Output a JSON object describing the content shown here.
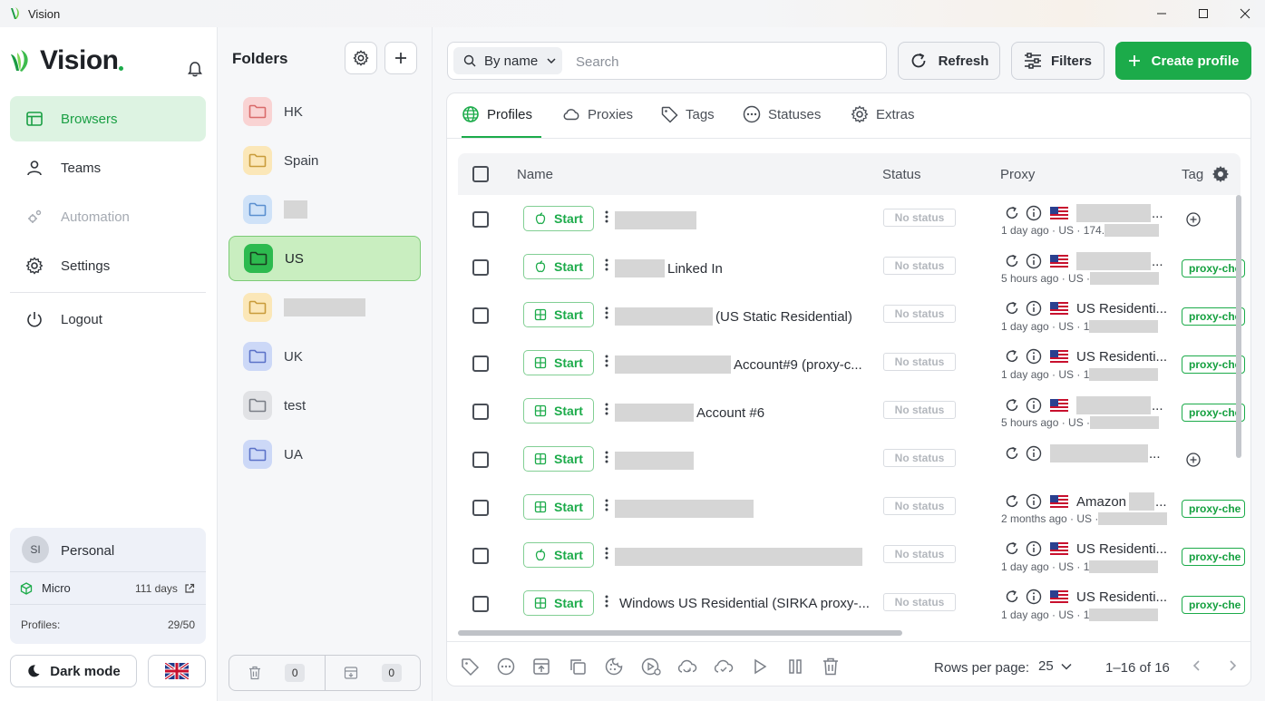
{
  "window": {
    "title": "Vision"
  },
  "sidebar": {
    "logo": "Vision",
    "nav": [
      {
        "label": "Browsers",
        "icon": "browsers-icon",
        "state": "active"
      },
      {
        "label": "Teams",
        "icon": "user-icon",
        "state": "normal"
      },
      {
        "label": "Automation",
        "icon": "automation-icon",
        "state": "disabled"
      },
      {
        "label": "Settings",
        "icon": "gear-icon",
        "state": "normal"
      },
      {
        "label": "Logout",
        "icon": "power-icon",
        "state": "normal"
      }
    ],
    "plan": {
      "avatar": "SI",
      "name": "Personal",
      "tier": "Micro",
      "days": "111 days",
      "profiles_label": "Profiles:",
      "profiles_count": "29/50"
    },
    "dark_mode_label": "Dark mode",
    "language_flag": "uk-flag-icon"
  },
  "folders": {
    "title": "Folders",
    "items": [
      {
        "name": "HK",
        "color": "#f9d3d3",
        "stroke": "#d96b6b"
      },
      {
        "name": "Spain",
        "color": "#fbe7b8",
        "stroke": "#c99c3b"
      },
      {
        "name": "",
        "color": "#cfe2f8",
        "stroke": "#5a8fd0"
      },
      {
        "name": "US",
        "color": "#2dba4f",
        "stroke": "#1a3d20"
      },
      {
        "name": "",
        "color": "#fbe7b8",
        "stroke": "#c99c3b"
      },
      {
        "name": "UK",
        "color": "#ccd8f7",
        "stroke": "#5b72c8"
      },
      {
        "name": "test",
        "color": "#e1e2e5",
        "stroke": "#7a7e86"
      },
      {
        "name": "UA",
        "color": "#ccd8f7",
        "stroke": "#5b72c8"
      }
    ],
    "active_index": 3,
    "trash_count": "0",
    "archive_count": "0"
  },
  "toolbar": {
    "search_mode": "By name",
    "search_placeholder": "Search",
    "refresh_label": "Refresh",
    "filters_label": "Filters",
    "create_label": "Create profile"
  },
  "tabs": [
    {
      "label": "Profiles",
      "icon": "globe-icon"
    },
    {
      "label": "Proxies",
      "icon": "cloud-icon"
    },
    {
      "label": "Tags",
      "icon": "tag-icon"
    },
    {
      "label": "Statuses",
      "icon": "dots-circle-icon"
    },
    {
      "label": "Extras",
      "icon": "gear-icon"
    }
  ],
  "table": {
    "columns": [
      "Name",
      "Status",
      "Proxy",
      "Tag"
    ],
    "rows": [
      {
        "os": "mac",
        "start": "Start",
        "name": "",
        "status": "No status",
        "proxy_name": "",
        "proxy_meta": "1 day ago · US · 174.",
        "flag": true,
        "tag": ""
      },
      {
        "os": "mac",
        "start": "Start",
        "name": "Linked In",
        "status": "No status",
        "proxy_name": "",
        "proxy_meta": "5 hours ago · US · ",
        "flag": true,
        "tag": "proxy-che"
      },
      {
        "os": "win",
        "start": "Start",
        "name": "(US Static Residential)",
        "status": "No status",
        "proxy_name": "US Residenti...",
        "proxy_meta": "1 day ago · US · 1",
        "flag": true,
        "tag": "proxy-che"
      },
      {
        "os": "win",
        "start": "Start",
        "name": "Account#9 (proxy-c...",
        "status": "No status",
        "proxy_name": "US Residenti...",
        "proxy_meta": "1 day ago · US · 1",
        "flag": true,
        "tag": "proxy-che"
      },
      {
        "os": "win",
        "start": "Start",
        "name": "Account #6",
        "status": "No status",
        "proxy_name": "",
        "proxy_meta": "5 hours ago · US · ",
        "flag": true,
        "tag": "proxy-che"
      },
      {
        "os": "win",
        "start": "Start",
        "name": "",
        "status": "No status",
        "proxy_name": "",
        "proxy_meta": "",
        "flag": false,
        "tag": ""
      },
      {
        "os": "win",
        "start": "Start",
        "name": "",
        "status": "No status",
        "proxy_name": "Amazon",
        "proxy_meta": "2 months ago · US · ",
        "flag": true,
        "tag": "proxy-che"
      },
      {
        "os": "mac",
        "start": "Start",
        "name": "",
        "status": "No status",
        "proxy_name": "US Residenti...",
        "proxy_meta": "1 day ago · US · 1",
        "flag": true,
        "tag": "proxy-che"
      },
      {
        "os": "win",
        "start": "Start",
        "name": "Windows US Residential (SIRKA proxy-...",
        "status": "No status",
        "proxy_name": "US Residenti...",
        "proxy_meta": "1 day ago · US · 1",
        "flag": true,
        "tag": "proxy-che"
      }
    ]
  },
  "footer": {
    "rows_per_page_label": "Rows per page:",
    "rows_per_page": "25",
    "range": "1–16 of 16"
  },
  "colors": {
    "accent": "#1cab4a",
    "accent_light": "#ddf3e2"
  }
}
